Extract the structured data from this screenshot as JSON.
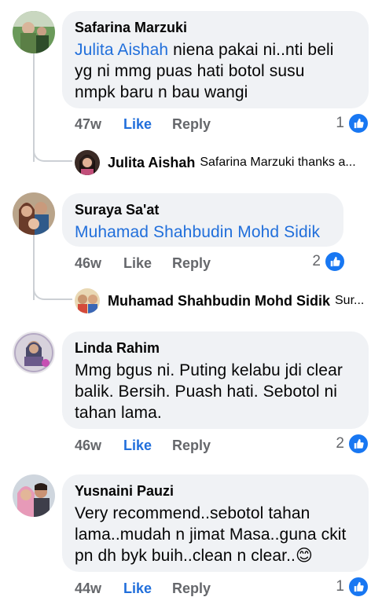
{
  "comments": [
    {
      "author": "Safarina Marzuki",
      "mention": "Julita Aishah",
      "line1_rest": " niena pakai ni..nti beli",
      "line2": "yg ni mmg puas hati botol susu",
      "line3": "nmpk baru n bau wangi",
      "time": "47w",
      "like_label": "Like",
      "reply_label": "Reply",
      "reaction_count": "1",
      "reply": {
        "author": "Julita Aishah",
        "snippet": "Safarina Marzuki thanks a..."
      }
    },
    {
      "author": "Suraya Sa'at",
      "mention": "Muhamad Shahbudin Mohd Sidik",
      "time": "46w",
      "like_label": "Like",
      "reply_label": "Reply",
      "reaction_count": "2",
      "reply": {
        "author": "Muhamad Shahbudin Mohd Sidik",
        "snippet": "Sur..."
      }
    },
    {
      "author": "Linda Rahim",
      "line1": "Mmg bgus ni. Puting kelabu jdi clear",
      "line2": "balik. Bersih. Puash hati. Sebotol ni",
      "line3": "tahan lama.",
      "time": "46w",
      "like_label": "Like",
      "reply_label": "Reply",
      "reaction_count": "2"
    },
    {
      "author": "Yusnaini Pauzi",
      "line1": "Very recommend..sebotol tahan",
      "line2": "lama..mudah n jimat Masa..guna ckit",
      "line3": "pn dh byk buih..clean n clear..",
      "emoji": "😊",
      "time": "44w",
      "like_label": "Like",
      "reply_label": "Reply",
      "reaction_count": "1"
    }
  ],
  "icons": {
    "reaction": "like-thumb-icon"
  },
  "colors": {
    "bubble": "#f0f2f5",
    "mention": "#216fdb",
    "meta": "#65676b",
    "like_active": "#216fdb",
    "reaction": "#1877f2"
  }
}
